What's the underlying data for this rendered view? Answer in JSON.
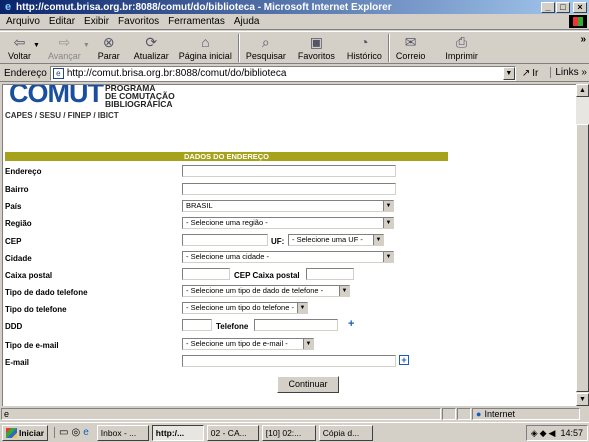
{
  "window": {
    "title": "http://comut.brisa.org.br:8088/comut/do/biblioteca - Microsoft Internet Explorer",
    "buttons": [
      "_",
      "□",
      "×"
    ]
  },
  "menu": [
    "Arquivo",
    "Editar",
    "Exibir",
    "Favoritos",
    "Ferramentas",
    "Ajuda"
  ],
  "toolbar": {
    "back": "Voltar",
    "forward": "Avançar",
    "stop": "Parar",
    "refresh": "Atualizar",
    "home": "Página inicial",
    "search": "Pesquisar",
    "favorites": "Favoritos",
    "history": "Histórico",
    "mail": "Correio",
    "print": "Imprimir",
    "more": "»"
  },
  "address": {
    "label": "Endereço",
    "url": "http://comut.brisa.org.br:8088/comut/do/biblioteca",
    "go": "Ir",
    "links": "Links »"
  },
  "logo": {
    "word": "COMUT",
    "line1": "PROGRAMA",
    "line2": "DE COMUTAÇÃO",
    "line3": "BIBLIOGRÁFICA",
    "sponsors": "CAPES / SESU / FINEP / IBICT"
  },
  "form": {
    "header": "DADOS DO ENDEREÇO",
    "endereco": "Endereço",
    "bairro": "Bairro",
    "pais": "País",
    "pais_value": "BRASIL",
    "regiao": "Região",
    "regiao_value": "- Selecione uma região -",
    "cep": "CEP",
    "uf": "UF:",
    "uf_value": "- Selecione uma UF -",
    "cidade": "Cidade",
    "cidade_value": "- Selecione uma cidade -",
    "caixa_postal": "Caixa postal",
    "cep_caixa_postal": "CEP Caixa postal",
    "tipo_dado_telefone": "Tipo de dado telefone",
    "tipo_dado_telefone_value": "- Selecione um tipo de dado de telefone -",
    "tipo_telefone": "Tipo do telefone",
    "tipo_telefone_value": "- Selecione um tipo do telefone -",
    "ddd": "DDD",
    "telefone": "Telefone",
    "tipo_email": "Tipo de e-mail",
    "tipo_email_value": "- Selecione um tipo de e-mail -",
    "email": "E-mail",
    "submit": "Continuar"
  },
  "status": {
    "zone": "Internet"
  },
  "taskbar": {
    "start": "Iniciar",
    "tasks": [
      "Inbox - ...",
      "http:/...",
      "02 - CA...",
      "[10] 02:...",
      "Cópia d..."
    ],
    "clock": "14:57"
  }
}
